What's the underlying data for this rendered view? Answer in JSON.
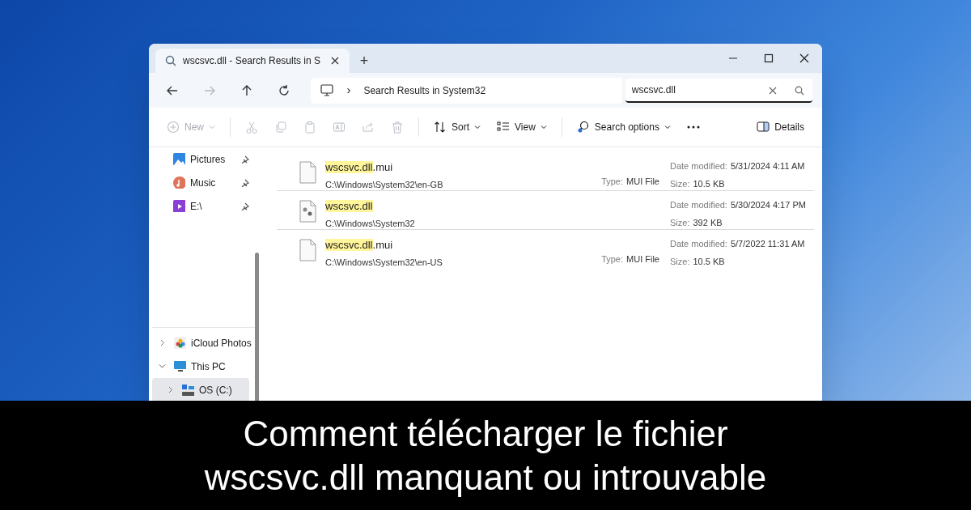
{
  "window": {
    "tab_title": "wscsvc.dll - Search Results in S",
    "new_tab": "+"
  },
  "nav": [
    {
      "kind": "back",
      "disabled": false
    },
    {
      "kind": "forward",
      "disabled": true
    },
    {
      "kind": "up",
      "disabled": false
    },
    {
      "kind": "refresh",
      "disabled": false
    }
  ],
  "address": {
    "chevron": "›",
    "path": "Search Results in System32"
  },
  "search": {
    "value": "wscsvc.dll"
  },
  "toolbar": [
    {
      "kind": "new",
      "label": "New",
      "dropdown": true,
      "disabled": true
    },
    {
      "kind": "separator"
    },
    {
      "kind": "cut",
      "disabled": true
    },
    {
      "kind": "copy",
      "disabled": true
    },
    {
      "kind": "paste",
      "disabled": true
    },
    {
      "kind": "rename",
      "disabled": true
    },
    {
      "kind": "share",
      "disabled": true
    },
    {
      "kind": "delete",
      "disabled": true
    },
    {
      "kind": "separator"
    },
    {
      "kind": "sort",
      "label": "Sort",
      "dropdown": true,
      "disabled": false
    },
    {
      "kind": "view",
      "label": "View",
      "dropdown": true,
      "disabled": false
    },
    {
      "kind": "separator"
    },
    {
      "kind": "search-options",
      "label": "Search options",
      "dropdown": true,
      "disabled": false
    },
    {
      "kind": "more",
      "disabled": false
    },
    {
      "kind": "spacer"
    },
    {
      "kind": "details",
      "label": "Details",
      "disabled": false
    }
  ],
  "sidebar": {
    "quick_access": [
      {
        "kind": "pictures",
        "label": "Pictures",
        "pinned": true
      },
      {
        "kind": "music",
        "label": "Music",
        "pinned": true
      },
      {
        "kind": "video",
        "label": "E:\\",
        "pinned": true
      }
    ],
    "tree": [
      {
        "kind": "photos",
        "label": "iCloud Photos",
        "expanded": false,
        "selected": false
      },
      {
        "kind": "pc",
        "label": "This PC",
        "expanded": true,
        "selected": false,
        "children": [
          {
            "kind": "drive",
            "label": "OS (C:)",
            "expanded": false,
            "selected": true
          }
        ]
      }
    ]
  },
  "results": [
    {
      "kind": "file",
      "name_parts": [
        {
          "text": "wscsvc.dll",
          "highlighted": true
        },
        {
          "text": ".mui",
          "highlighted": false
        }
      ],
      "path": "C:\\Windows\\System32\\en-GB",
      "type_label": "Type:",
      "type": "MUI File",
      "date_label": "Date modified:",
      "date": "5/31/2024 4:11 AM",
      "size_label": "Size:",
      "size": "10.5 KB"
    },
    {
      "kind": "system",
      "name_parts": [
        {
          "text": "wscsvc.dll",
          "highlighted": true
        }
      ],
      "path": "C:\\Windows\\System32",
      "date_label": "Date modified:",
      "date": "5/30/2024 4:17 PM",
      "size_label": "Size:",
      "size": "392 KB"
    },
    {
      "kind": "file",
      "name_parts": [
        {
          "text": "wscsvc.dll",
          "highlighted": true
        },
        {
          "text": ".mui",
          "highlighted": false
        }
      ],
      "path": "C:\\Windows\\System32\\en-US",
      "type_label": "Type:",
      "type": "MUI File",
      "date_label": "Date modified:",
      "date": "5/7/2022 11:31 AM",
      "size_label": "Size:",
      "size": "10.5 KB"
    }
  ],
  "caption": {
    "lines": [
      "Comment télécharger le fichier",
      "wscsvc.dll manquant ou introuvable"
    ]
  }
}
